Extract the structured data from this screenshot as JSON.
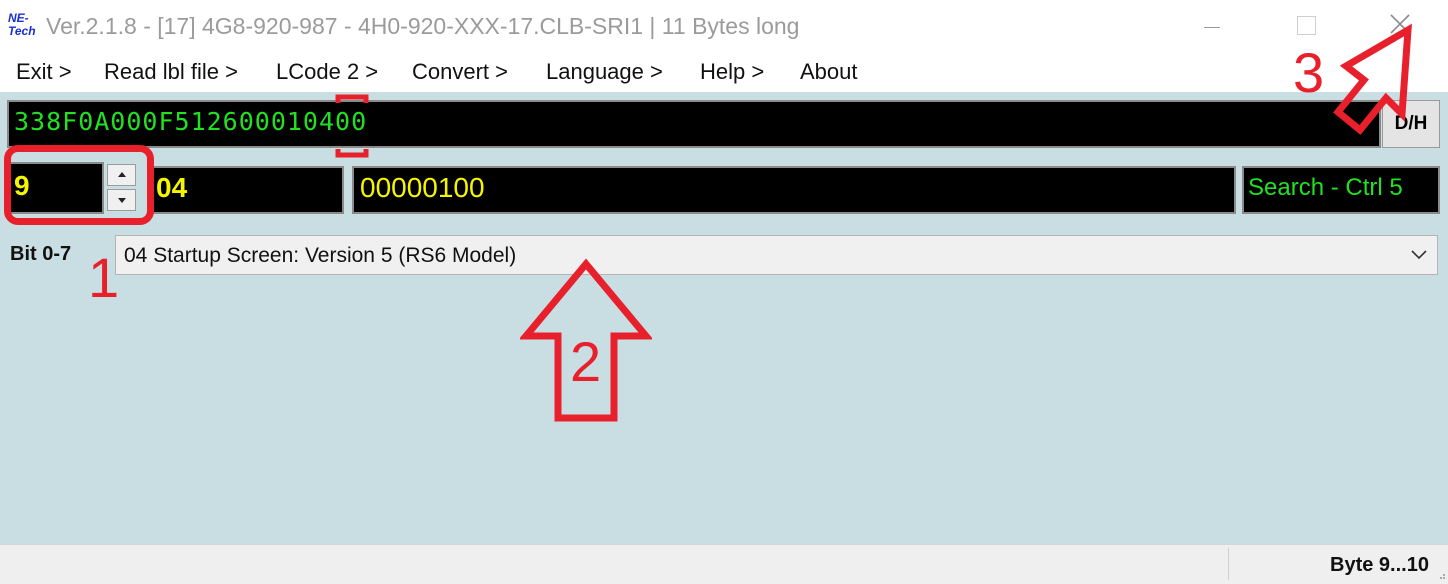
{
  "window": {
    "logo": "NE-\nTech",
    "title": "Ver.2.1.8 - [17] 4G8-920-987 - 4H0-920-XXX-17.CLB-SRI1 | 11 Bytes long"
  },
  "menu": [
    {
      "label": "Exit >"
    },
    {
      "label": "Read lbl file >"
    },
    {
      "label": "LCode 2 >"
    },
    {
      "label": "Convert >"
    },
    {
      "label": "Language >"
    },
    {
      "label": "Help >"
    },
    {
      "label": "About"
    }
  ],
  "coding": {
    "hex_string": "338F0A000F512600010400",
    "dh_button": "D/H"
  },
  "byte_editor": {
    "byte_index": "9",
    "hex_value": "04",
    "binary_value": "00000100",
    "search_label": "Search - Ctrl 5"
  },
  "bit_selector": {
    "label": "Bit 0-7",
    "selected_option": "04 Startup Screen: Version 5 (RS6 Model)"
  },
  "annotations": {
    "marker_1": "1",
    "marker_2": "2",
    "marker_3": "3"
  },
  "status": {
    "byte_range": "Byte 9...10"
  },
  "colors": {
    "annotation_red": "#e8202c",
    "hex_text_green": "#22e022",
    "value_yellow": "#f5f500",
    "client_bg": "#c8dee2"
  },
  "icons": {
    "spin_up": "triangle-up",
    "spin_down": "triangle-down",
    "dropdown": "chevron-down",
    "close": "x-mark",
    "minimize": "dash",
    "maximize": "square"
  }
}
